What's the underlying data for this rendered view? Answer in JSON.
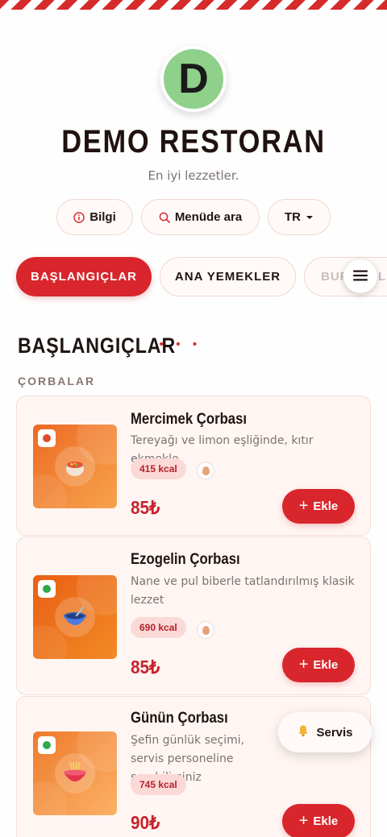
{
  "brand": {
    "logo_letter": "D",
    "logo_color": "#8fd08a",
    "name": "DEMO RESTORAN",
    "tagline": "En iyi lezzetler."
  },
  "header_actions": {
    "info_label": "Bilgi",
    "search_label": "Menüde ara",
    "language": "TR"
  },
  "tabs": [
    {
      "label": "BAŞLANGIÇLAR",
      "active": true
    },
    {
      "label": "ANA YEMEKLER",
      "active": false
    },
    {
      "label": "BURGERLER",
      "active": false
    }
  ],
  "section": {
    "title": "BAŞLANGIÇLAR",
    "dots": "• • •",
    "category": "ÇORBALAR"
  },
  "items": [
    {
      "name": "Mercimek Çorbası",
      "description": "Tereyağı ve limon eşliğinde, kıtır ekmekle",
      "kcal": "415 kcal",
      "allergen_icon": "egg-icon",
      "price": "85₺",
      "add_label": "Ekle",
      "image_icon": "stew-pot-icon"
    },
    {
      "name": "Ezogelin Çorbası",
      "description": "Nane ve pul biberle tatlandırılmış klasik lezzet",
      "kcal": "690 kcal",
      "allergen_icon": "egg-icon",
      "price": "85₺",
      "add_label": "Ekle",
      "image_icon": "soup-bowl-icon"
    },
    {
      "name": "Günün Çorbası",
      "description": "Şefin günlük seçimi, servis personeline sorabilirsiniz",
      "kcal": "745 kcal",
      "price": "90₺",
      "add_label": "Ekle",
      "image_icon": "noodle-bowl-icon"
    }
  ],
  "service_button": {
    "label": "Servis",
    "icon": "bell-icon"
  },
  "colors": {
    "accent": "#d8262c",
    "veg_dot": "#2eaa4a",
    "card_bg": "#fff6f3"
  }
}
